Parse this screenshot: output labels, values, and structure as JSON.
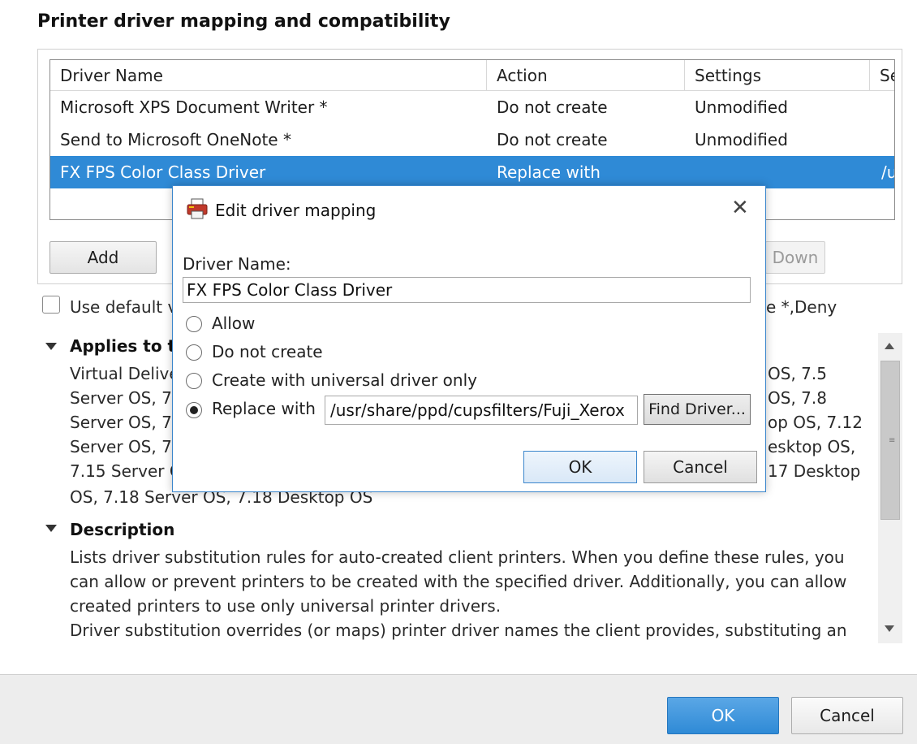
{
  "page": {
    "title": "Printer driver mapping and compatibility"
  },
  "table": {
    "headers": [
      "Driver Name",
      "Action",
      "Settings",
      "Se"
    ],
    "rows": [
      {
        "driver": "Microsoft XPS Document Writer *",
        "action": "Do not create",
        "settings": "Unmodified",
        "extra": ""
      },
      {
        "driver": "Send to Microsoft OneNote *",
        "action": "Do not create",
        "settings": "Unmodified",
        "extra": ""
      },
      {
        "driver": "FX FPS Color Class Driver",
        "action": "Replace with",
        "settings": "",
        "extra": "/u"
      }
    ],
    "selected_row": 2
  },
  "table_buttons": {
    "add": "Add",
    "down": "Down"
  },
  "use_default": {
    "label_left": "Use default v",
    "label_right": "e *,Deny"
  },
  "applies": {
    "heading": "Applies to th",
    "left_lines": [
      "Virtual Delive",
      "Server OS, 7.",
      "Server OS, 7.",
      "Server OS, 7.",
      "7.15 Server C"
    ],
    "right_lines": [
      "OS, 7.5",
      "OS, 7.8",
      "op OS, 7.12",
      "esktop OS,",
      "17 Desktop"
    ],
    "last_line": "OS, 7.18 Server OS, 7.18 Desktop OS"
  },
  "description": {
    "heading": "Description",
    "lines": [
      "Lists driver substitution rules for auto-created client printers. When you define these rules, you",
      "can allow or prevent printers to be created with the specified driver. Additionally, you can allow",
      "created printers to use only universal printer drivers.",
      "Driver substitution overrides (or maps) printer driver names the client provides, substituting an"
    ]
  },
  "footer": {
    "ok": "OK",
    "cancel": "Cancel"
  },
  "dialog": {
    "title": "Edit driver mapping",
    "close_glyph": "✕",
    "driver_name_label": "Driver Name:",
    "driver_name_value": "FX FPS Color Class Driver",
    "options": [
      "Allow",
      "Do not create",
      "Create with universal driver only",
      "Replace with"
    ],
    "selected_option": 3,
    "replace_path": "/usr/share/ppd/cupsfilters/Fuji_Xerox",
    "find_driver": "Find Driver...",
    "ok": "OK",
    "cancel": "Cancel"
  },
  "icons": {
    "dialog_icon": "printer-icon",
    "collapse": "triangle-down-icon",
    "close": "close-icon"
  },
  "colors": {
    "selection": "#2f8ad6",
    "dialog_border": "#3b86cc",
    "primary_button": "#2f8ad6"
  }
}
